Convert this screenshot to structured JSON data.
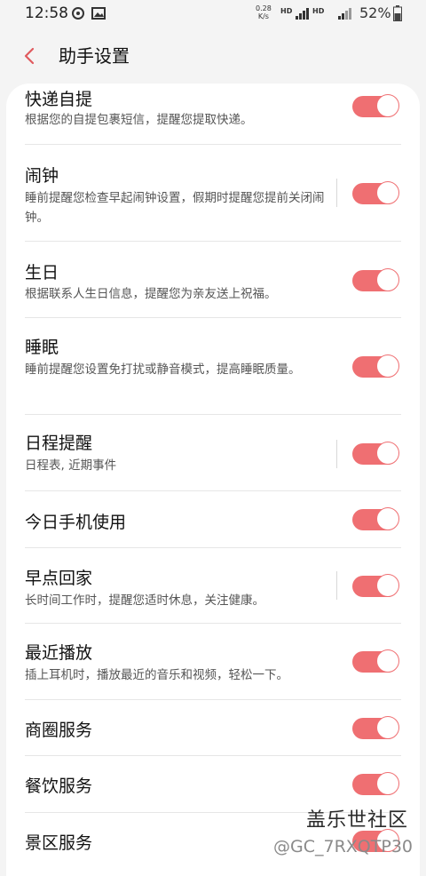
{
  "status_bar": {
    "time": "12:58",
    "net_speed_value": "0.28",
    "net_speed_unit": "K/s",
    "hd1": "HD",
    "hd2": "HD",
    "battery": "52%"
  },
  "header": {
    "title": "助手设置",
    "back_icon": "chevron-left-icon"
  },
  "accent_color": "#ef6f72",
  "items": [
    {
      "title": "快递自提",
      "desc": "根据您的自提包裹短信，提醒您提取快递。",
      "enabled": true
    },
    {
      "title": "闹钟",
      "desc": "睡前提醒您检查早起闹钟设置，假期时提醒您提前关闭闹钟。",
      "enabled": true
    },
    {
      "title": "生日",
      "desc": "根据联系人生日信息，提醒您为亲友送上祝福。",
      "enabled": true
    },
    {
      "title": "睡眠",
      "desc": "睡前提醒您设置免打扰或静音模式，提高睡眠质量。",
      "enabled": true
    },
    {
      "title": "日程提醒",
      "desc": "日程表, 近期事件",
      "enabled": true
    },
    {
      "title": "今日手机使用",
      "desc": "",
      "enabled": true
    },
    {
      "title": "早点回家",
      "desc": "长时间工作时，提醒您适时休息，关注健康。",
      "enabled": true
    },
    {
      "title": "最近播放",
      "desc": "插上耳机时，播放最近的音乐和视频，轻松一下。",
      "enabled": true
    },
    {
      "title": "商圈服务",
      "desc": "",
      "enabled": true
    },
    {
      "title": "餐饮服务",
      "desc": "",
      "enabled": true
    },
    {
      "title": "景区服务",
      "desc": "",
      "enabled": true
    }
  ],
  "watermark": {
    "line1": "盖乐世社区",
    "line2": "@GC_7RXQTP30"
  }
}
